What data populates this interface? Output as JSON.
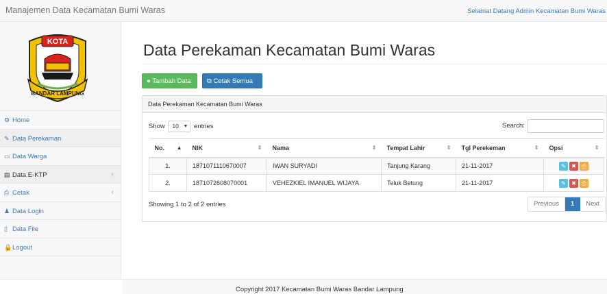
{
  "header": {
    "brand": "Manajemen Data Kecamatan Bumi Waras",
    "welcome": "Selamat Datang Admin Kecamatan Bumi Waras"
  },
  "logo": {
    "text_top": "KOTA",
    "text_bottom": "BANDAR LAMPUNG"
  },
  "sidebar": {
    "items": [
      {
        "label": "Home",
        "icon": "dashboard-icon",
        "glyph": "⚙"
      },
      {
        "label": "Data Perekaman",
        "icon": "edit-icon",
        "glyph": "✎"
      },
      {
        "label": "Data Warga",
        "icon": "desktop-icon",
        "glyph": "▭"
      },
      {
        "label": "Data E-KTP",
        "icon": "table-icon",
        "glyph": "▤",
        "caret": "‹"
      },
      {
        "label": "Cetak",
        "icon": "print-icon",
        "glyph": "⎙",
        "caret": "‹"
      },
      {
        "label": "Data Login",
        "icon": "user-icon",
        "glyph": "♟"
      },
      {
        "label": "Data File",
        "icon": "file-icon",
        "glyph": "▯"
      },
      {
        "label": "Logout",
        "icon": "lock-icon",
        "glyph": "🔒"
      }
    ]
  },
  "main": {
    "title": "Data Perekaman Kecamatan Bumi Waras",
    "add_button": "Tambah Data",
    "print_all_button": "Cetak Semua",
    "panel_heading": "Data Perekaman Kecamatan Bumi Waras",
    "show_label": "Show",
    "show_value": "10",
    "entries_label": "entries",
    "search_label": "Search:",
    "search_value": "",
    "columns": [
      "No.",
      "NIK",
      "Nama",
      "Tempat Lahir",
      "Tgl Perekeman",
      "Opsi"
    ],
    "rows": [
      {
        "no": "1.",
        "nik": "1871071110670007",
        "nama": "IWAN SURYADI",
        "tempat_lahir": "Tanjung Karang",
        "tgl": "21-11-2017"
      },
      {
        "no": "2.",
        "nik": "1871072608070001",
        "nama": "VEHEZKIEL IMANUEL WIJAYA",
        "tempat_lahir": "Teluk Betung",
        "tgl": "21-11-2017"
      }
    ],
    "info": "Showing 1 to 2 of 2 entries",
    "pagination": {
      "previous": "Previous",
      "current": "1",
      "next": "Next"
    }
  },
  "footer": {
    "copyright": "Copyright 2017 Kecamatan Bumi Waras Bandar Lampung"
  },
  "colors": {
    "link": "#337ab7",
    "success": "#5cb85c",
    "primary": "#337ab7",
    "info": "#5bc0de",
    "danger": "#d9534f",
    "warning": "#f0ad4e"
  }
}
